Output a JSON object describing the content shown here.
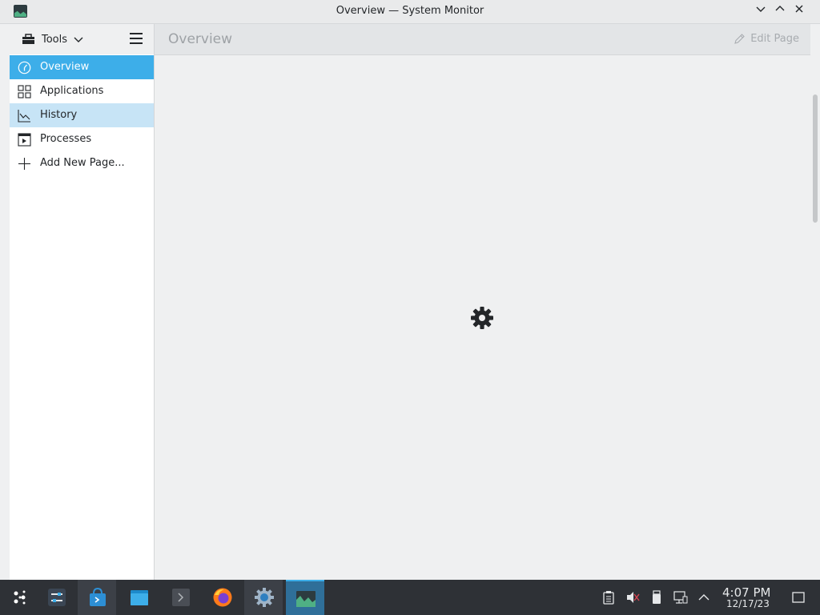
{
  "window": {
    "title": "Overview — System Monitor",
    "controls": [
      "minimize",
      "maximize",
      "close"
    ]
  },
  "sidebar": {
    "tools_label": "Tools",
    "items": [
      {
        "label": "Overview",
        "icon": "gauge-icon",
        "state": "selected"
      },
      {
        "label": "Applications",
        "icon": "grid-icon",
        "state": "normal"
      },
      {
        "label": "History",
        "icon": "line-chart-icon",
        "state": "hover"
      },
      {
        "label": "Processes",
        "icon": "process-window-icon",
        "state": "normal"
      },
      {
        "label": "Add New Page...",
        "icon": "plus-icon",
        "state": "normal"
      }
    ]
  },
  "main": {
    "page_title": "Overview",
    "edit_page_label": "Edit Page",
    "loading_icon": "gear-icon"
  },
  "taskbar": {
    "apps": [
      "application-launcher",
      "system-settings",
      "discover-store",
      "file-manager",
      "terminal",
      "firefox",
      "kde-settings",
      "system-monitor"
    ],
    "tray": [
      "clipboard-icon",
      "volume-muted-icon",
      "usb-drive-icon",
      "network-icon",
      "show-more-icon"
    ],
    "time": "4:07 PM",
    "date": "12/17/23"
  },
  "colors": {
    "accent": "#3daee9",
    "hover": "#c7e4f6",
    "taskbar": "#2e3136"
  }
}
